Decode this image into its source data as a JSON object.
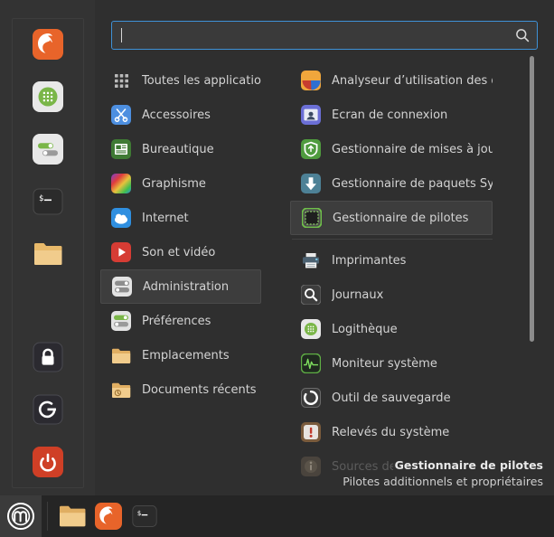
{
  "search": {
    "value": "",
    "placeholder": "",
    "icon": "search-icon"
  },
  "favorites": {
    "top": [
      {
        "name": "firefox",
        "label": "Firefox"
      },
      {
        "name": "software-manager",
        "label": "Logithèque"
      },
      {
        "name": "system-settings",
        "label": "Préférences système"
      },
      {
        "name": "terminal",
        "label": "Terminal"
      },
      {
        "name": "files",
        "label": "Gestionnaire de fichiers"
      }
    ],
    "bottom": [
      {
        "name": "lock-screen",
        "label": "Verrouiller l'écran"
      },
      {
        "name": "log-out",
        "label": "Fermer la session"
      },
      {
        "name": "quit",
        "label": "Quitter"
      }
    ]
  },
  "categories": [
    {
      "label": "Toutes les applications",
      "icon": "grid-icon",
      "selected": false
    },
    {
      "label": "Accessoires",
      "icon": "accessories-icon",
      "selected": false
    },
    {
      "label": "Bureautique",
      "icon": "office-icon",
      "selected": false
    },
    {
      "label": "Graphisme",
      "icon": "graphics-icon",
      "selected": false
    },
    {
      "label": "Internet",
      "icon": "internet-icon",
      "selected": false
    },
    {
      "label": "Son et vidéo",
      "icon": "multimedia-icon",
      "selected": false
    },
    {
      "label": "Administration",
      "icon": "administration-icon",
      "selected": true
    },
    {
      "label": "Préférences",
      "icon": "preferences-icon",
      "selected": false
    },
    {
      "label": "Emplacements",
      "icon": "places-folder-icon",
      "selected": false
    },
    {
      "label": "Documents récents",
      "icon": "recent-documents-icon",
      "selected": false
    }
  ],
  "applications": [
    {
      "label": "Analyseur d’utilisation des d…",
      "icon": "disk-usage-analyzer-icon",
      "selected": false,
      "dim": false
    },
    {
      "label": "Écran de connexion",
      "icon": "login-window-icon",
      "selected": false,
      "dim": false
    },
    {
      "label": "Gestionnaire de mises à jour",
      "icon": "update-manager-icon",
      "selected": false,
      "dim": false
    },
    {
      "label": "Gestionnaire de paquets Syn…",
      "icon": "synaptic-icon",
      "selected": false,
      "dim": false
    },
    {
      "label": "Gestionnaire de pilotes",
      "icon": "driver-manager-icon",
      "selected": true,
      "dim": false
    },
    {
      "label": "Imprimantes",
      "icon": "printers-icon",
      "selected": false,
      "dim": false
    },
    {
      "label": "Journaux",
      "icon": "logs-icon",
      "selected": false,
      "dim": false
    },
    {
      "label": "Logithèque",
      "icon": "software-manager-icon",
      "selected": false,
      "dim": false
    },
    {
      "label": "Moniteur système",
      "icon": "system-monitor-icon",
      "selected": false,
      "dim": false
    },
    {
      "label": "Outil de sauvegarde",
      "icon": "backup-tool-icon",
      "selected": false,
      "dim": false
    },
    {
      "label": "Relevés du système",
      "icon": "system-reports-icon",
      "selected": false,
      "dim": false
    },
    {
      "label": "Sources de logiciels",
      "icon": "software-sources-icon",
      "selected": false,
      "dim": true
    }
  ],
  "status": {
    "title": "Gestionnaire de pilotes",
    "description": "Pilotes additionnels et propriétaires"
  },
  "taskbar": {
    "menu_label": "Menu",
    "items": [
      {
        "name": "files",
        "label": "Gestionnaire de fichiers"
      },
      {
        "name": "firefox",
        "label": "Firefox"
      },
      {
        "name": "terminal",
        "label": "Terminal"
      }
    ]
  },
  "colors": {
    "accent_blue": "#3f91d6",
    "panel_bg": "#2f2f2f",
    "sidebar_bg": "#333333",
    "taskbar_bg": "#252525",
    "selection_bg": "#3d3d3d",
    "text": "#d3d3d3",
    "mint_green": "#8ab92f",
    "firefox_orange": "#e8642a",
    "quit_red": "#cf3f26"
  }
}
